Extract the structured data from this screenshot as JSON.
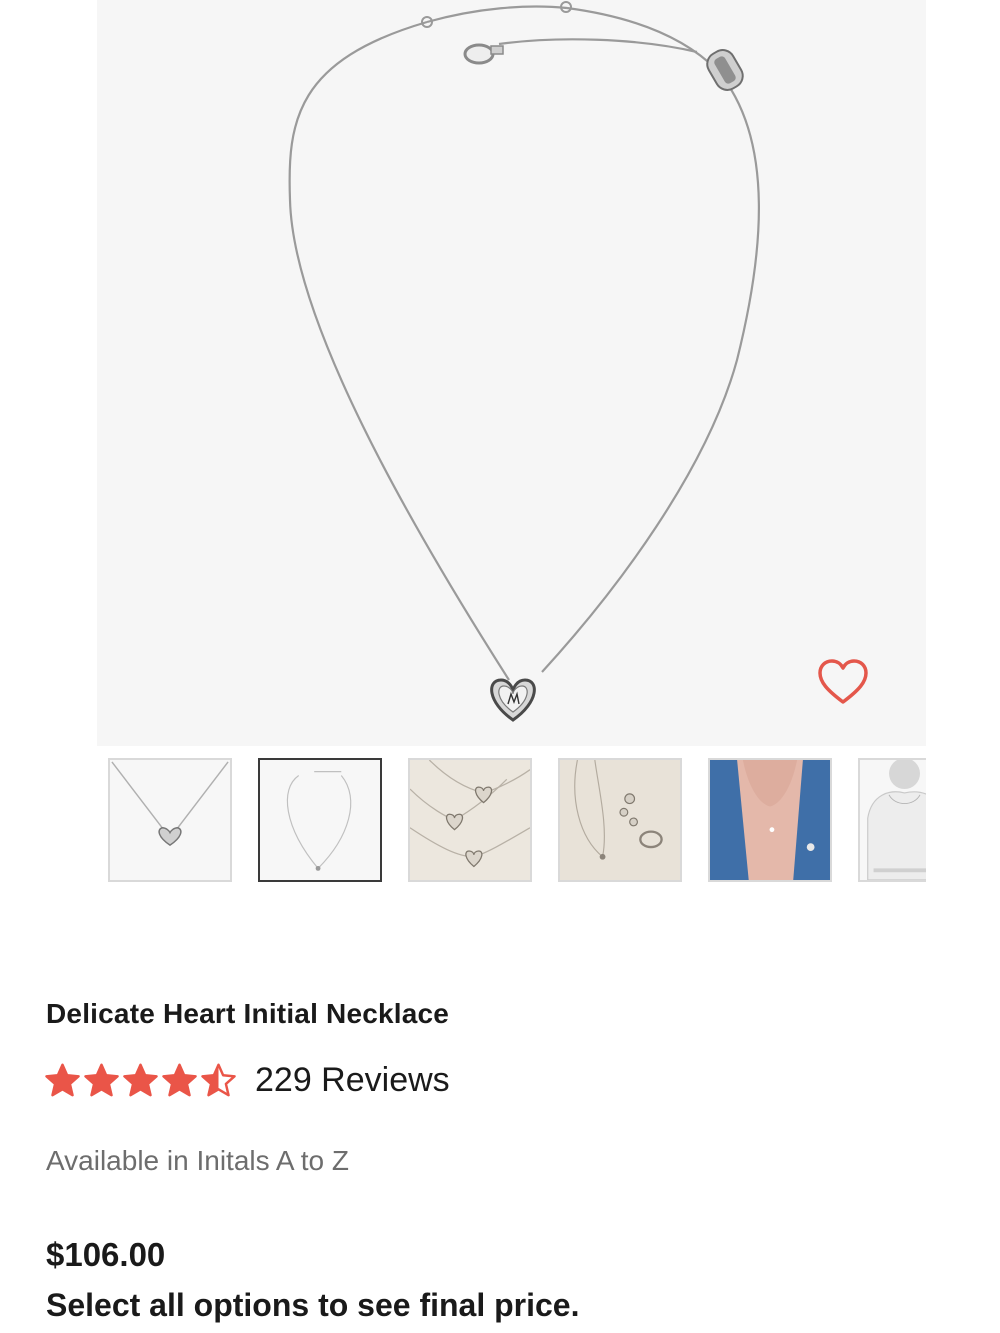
{
  "product": {
    "title": "Delicate Heart Initial Necklace",
    "rating_value": 4.5,
    "rating_max": 5,
    "reviews_label": "229 Reviews",
    "availability": "Available in Initals A to Z",
    "price": "$106.00",
    "price_note": "Select all options to see final price."
  },
  "gallery": {
    "main_image": "silver-heart-initial-necklace",
    "wishlist_icon": "heart-outline-icon",
    "selected_index": 1,
    "thumbnails": [
      "heart-pendant-closeup",
      "full-necklace-view",
      "multiple-heart-pendants",
      "necklace-charms-and-ring",
      "model-wearing-necklace",
      "size-guide-figure"
    ]
  },
  "colors": {
    "star": "#ea5548",
    "wishlist": "#e4574b",
    "hero_bg": "#f6f6f6",
    "thumb_border": "#d9d9d9",
    "thumb_selected_border": "#3a3a3a"
  }
}
